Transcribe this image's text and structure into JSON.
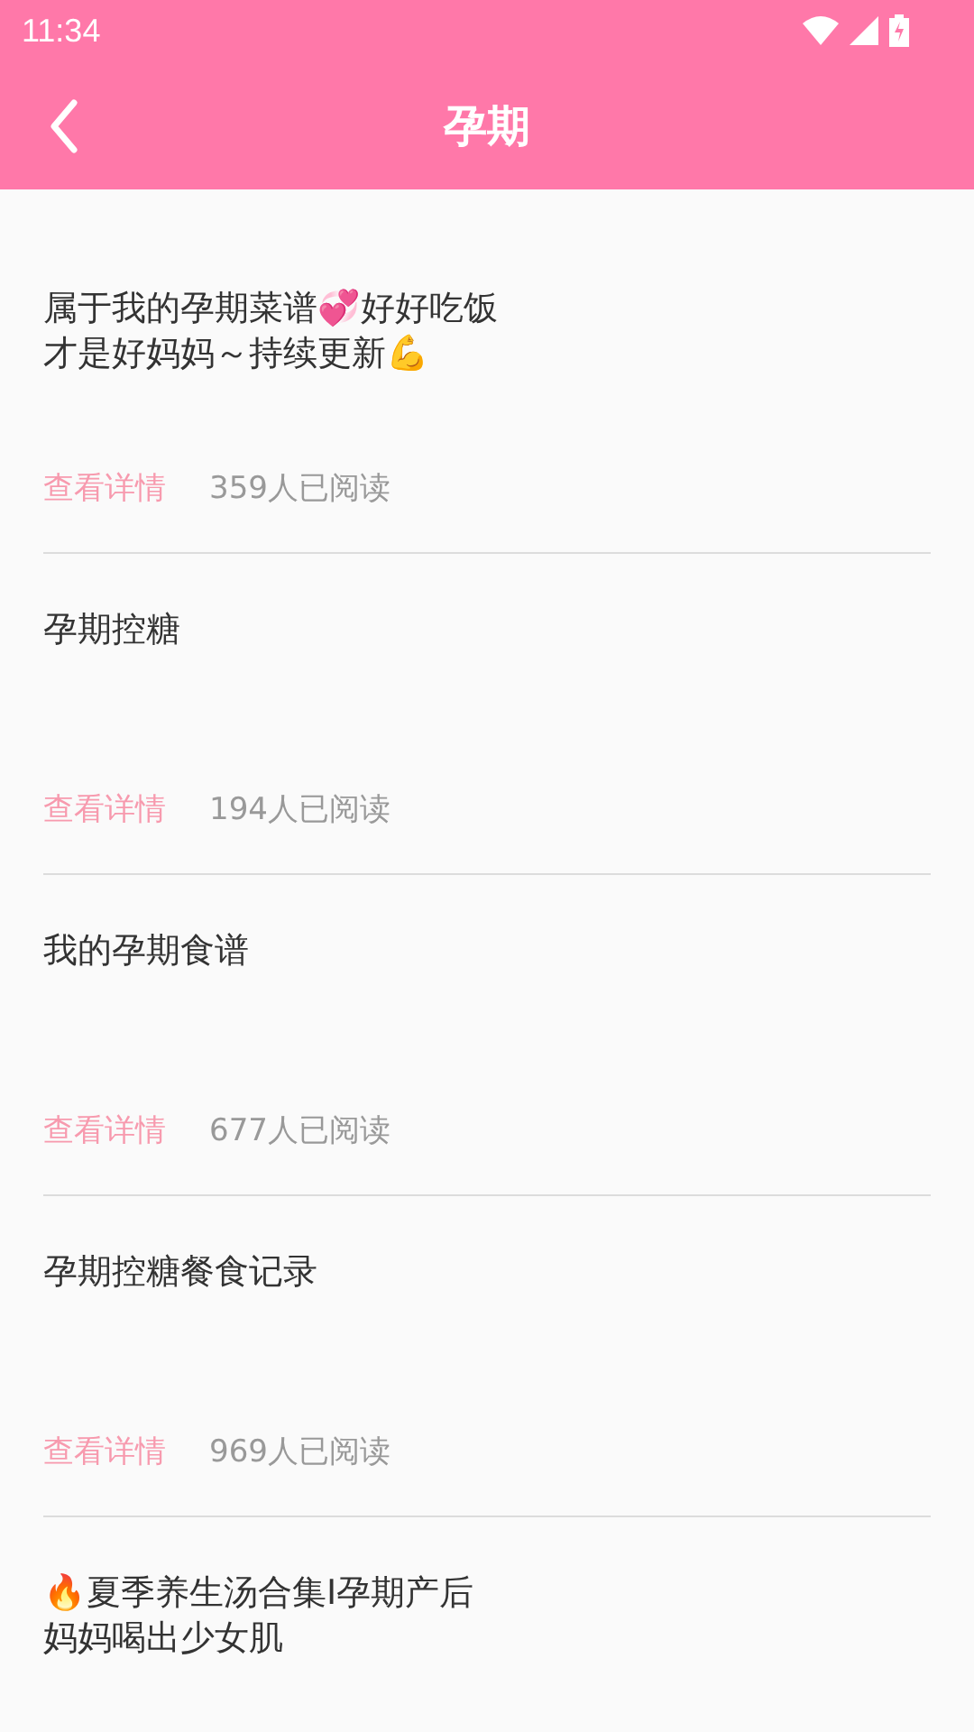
{
  "status_bar": {
    "time": "11:34"
  },
  "header": {
    "title": "孕期"
  },
  "articles": [
    {
      "title": "属于我的孕期菜谱💞好好吃饭才是好妈妈～持续更新💪",
      "link": "查看详情",
      "reads": "359人已阅读"
    },
    {
      "title": "孕期控糖",
      "link": "查看详情",
      "reads": "194人已阅读"
    },
    {
      "title": "我的孕期食谱",
      "link": "查看详情",
      "reads": "677人已阅读"
    },
    {
      "title": "孕期控糖餐食记录",
      "link": "查看详情",
      "reads": "969人已阅读"
    },
    {
      "title": "🔥夏季养生汤合集I孕期产后妈妈喝出少女肌"
    }
  ]
}
